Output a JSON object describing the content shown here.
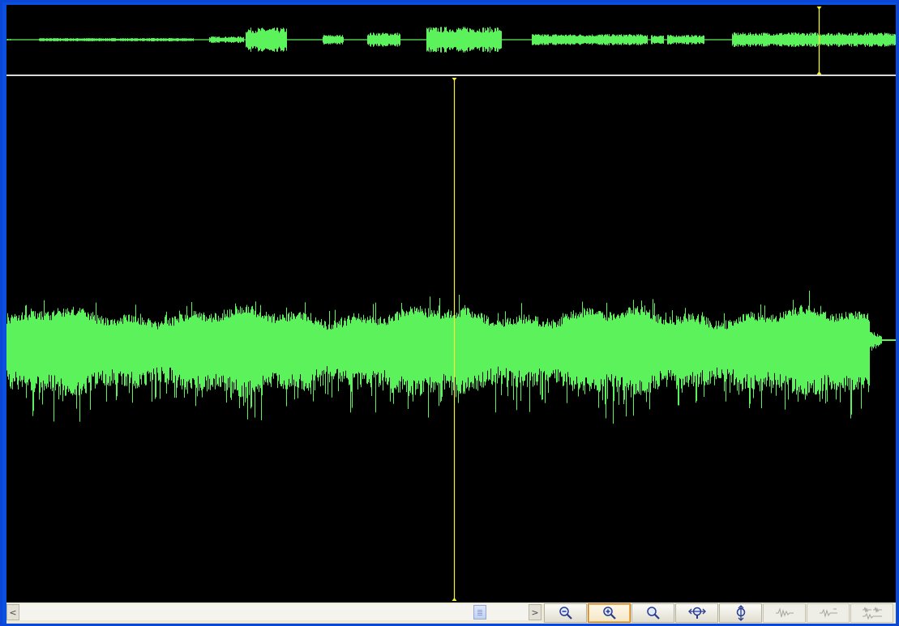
{
  "colors": {
    "waveform": "#5cf25c",
    "cursor": "#f3f339",
    "background": "#000000",
    "frame": "#0b4fe0"
  },
  "overview": {
    "cursor_position": 0.913
  },
  "main_view": {
    "cursor_position": 0.5
  },
  "scrollbar": {
    "left_icon": "scroll-left-arrow",
    "left_glyph": "<",
    "right_icon": "scroll-right-arrow",
    "right_glyph": ">",
    "thumb_position": 0.9
  },
  "toolbar": {
    "buttons": [
      {
        "icon": "zoom-out-icon",
        "state": "normal"
      },
      {
        "icon": "zoom-in-icon",
        "state": "active"
      },
      {
        "icon": "zoom-normal-icon",
        "state": "normal"
      },
      {
        "icon": "zoom-fit-horizontal-icon",
        "state": "normal"
      },
      {
        "icon": "zoom-fit-vertical-icon",
        "state": "normal"
      },
      {
        "icon": "waveform-view-icon",
        "state": "disabled"
      },
      {
        "icon": "waveform-decrease-icon",
        "state": "disabled"
      },
      {
        "icon": "waveform-increase-icon",
        "state": "disabled"
      }
    ]
  }
}
